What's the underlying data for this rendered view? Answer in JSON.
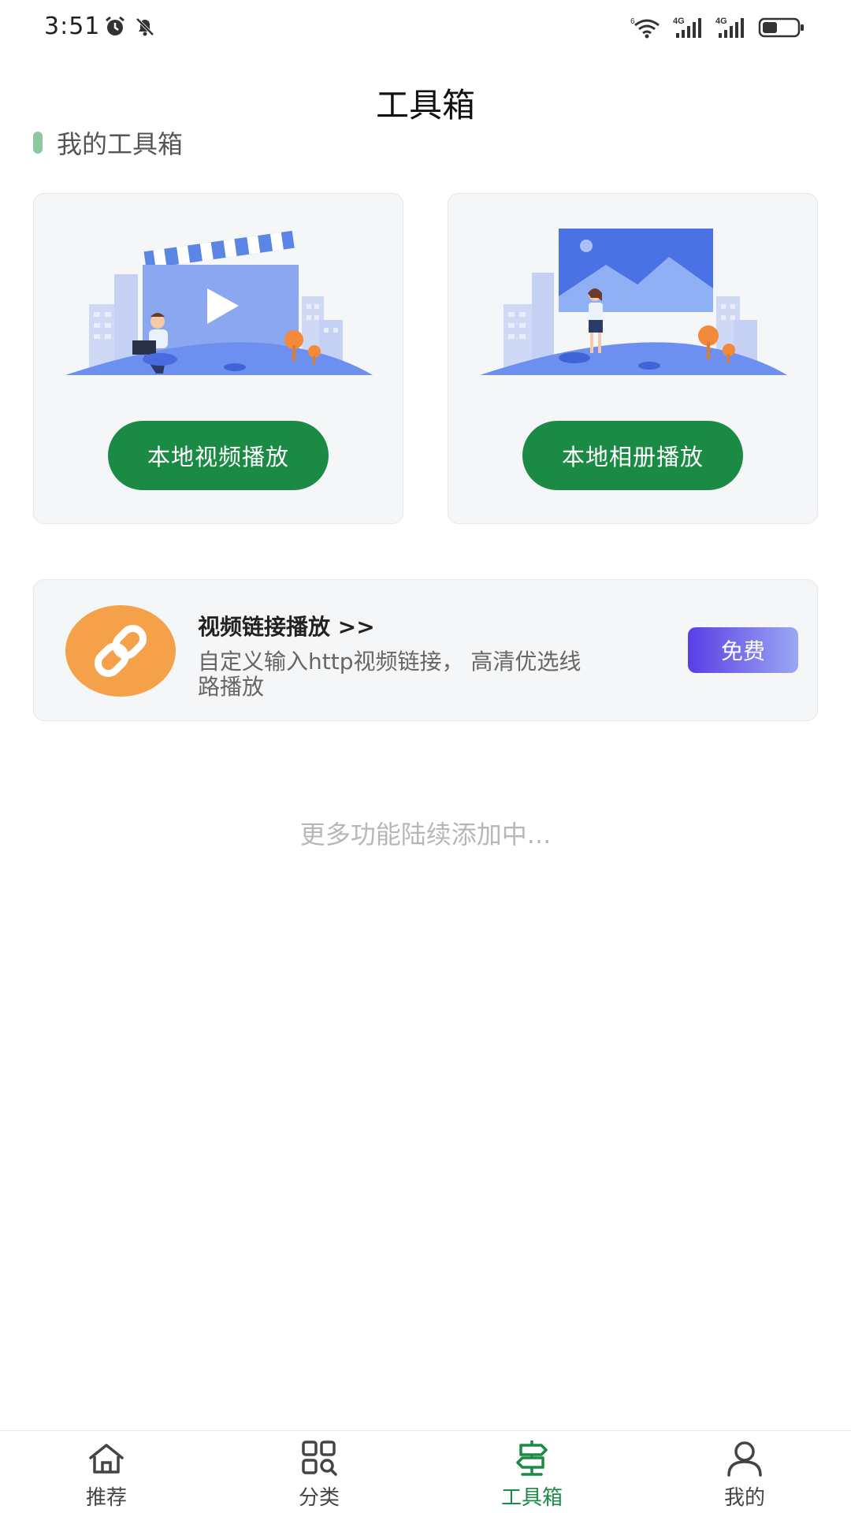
{
  "status_bar": {
    "time": "3:51",
    "icons": [
      "alarm-icon",
      "bell-off-icon",
      "wifi-icon",
      "signal-4g-icon",
      "signal-4g-icon",
      "battery-icon"
    ],
    "network_label_1": "4G",
    "network_label_2": "4G"
  },
  "header": {
    "title": "工具箱"
  },
  "section": {
    "title": "我的工具箱"
  },
  "tools": [
    {
      "button_label": "本地视频播放",
      "illustration": "video-illustration"
    },
    {
      "button_label": "本地相册播放",
      "illustration": "photo-illustration"
    }
  ],
  "link_card": {
    "title": "视频链接播放 >>",
    "description": "自定义输入http视频链接， 高清优选线路播放",
    "badge": "免费",
    "icon": "link-icon"
  },
  "footer_note": "更多功能陆续添加中...",
  "bottom_nav": {
    "active_index": 2,
    "items": [
      {
        "label": "推荐",
        "icon": "home-icon"
      },
      {
        "label": "分类",
        "icon": "category-search-icon"
      },
      {
        "label": "工具箱",
        "icon": "signpost-icon"
      },
      {
        "label": "我的",
        "icon": "user-icon"
      }
    ]
  },
  "colors": {
    "primary_green": "#1a8a45",
    "section_bar": "#8fc7a0",
    "link_icon_bg": "#f4a149",
    "badge_gradient_start": "#5a3ee6",
    "badge_gradient_end": "#9aa8f2",
    "card_bg": "#f4f6f8"
  }
}
